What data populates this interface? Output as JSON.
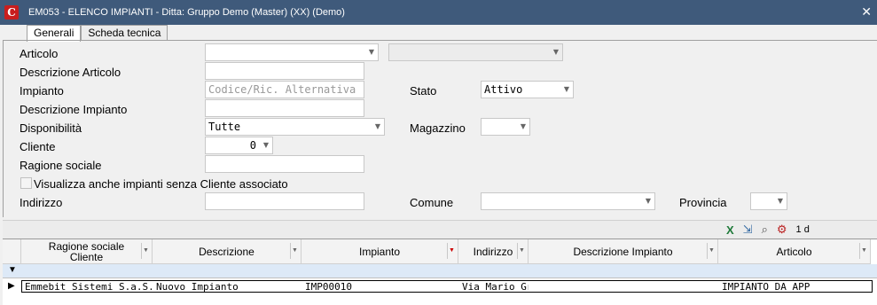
{
  "window": {
    "title": "EM053 - ELENCO IMPIANTI - Ditta: Gruppo Demo (Master) (XX)  (Demo)",
    "app_icon": "C",
    "close": "✕"
  },
  "tabs": [
    {
      "label": "Generali"
    },
    {
      "label": "Scheda tecnica"
    }
  ],
  "form": {
    "articolo": {
      "label": "Articolo",
      "value": ""
    },
    "descrizione_articolo": {
      "label": "Descrizione Articolo",
      "value": ""
    },
    "impianto": {
      "label": "Impianto",
      "placeholder": "Codice/Ric. Alternativa"
    },
    "stato": {
      "label": "Stato",
      "value": "Attivo"
    },
    "descrizione_impianto": {
      "label": "Descrizione Impianto",
      "value": ""
    },
    "disponibilita": {
      "label": "Disponibilità",
      "value": "Tutte"
    },
    "magazzino": {
      "label": "Magazzino",
      "value": ""
    },
    "cliente": {
      "label": "Cliente",
      "value": "0"
    },
    "ragione_sociale": {
      "label": "Ragione sociale",
      "value": ""
    },
    "visualizza": {
      "label": "Visualizza anche impianti senza Cliente associato"
    },
    "indirizzo": {
      "label": "Indirizzo",
      "value": ""
    },
    "comune": {
      "label": "Comune",
      "value": ""
    },
    "provincia": {
      "label": "Provincia",
      "value": ""
    }
  },
  "toolbar": {
    "page_text": "1 d"
  },
  "grid": {
    "columns": [
      {
        "label": "Ragione sociale\nCliente"
      },
      {
        "label": "Descrizione"
      },
      {
        "label": "Impianto"
      },
      {
        "label": "Indirizzo"
      },
      {
        "label": "Descrizione Impianto"
      },
      {
        "label": "Articolo"
      }
    ],
    "rows": [
      {
        "ragione_sociale": "Emmebit Sistemi S.a.S.",
        "descrizione": "Nuovo Impianto",
        "impianto": "IMP00010",
        "indirizzo": "Via Mario Gr",
        "descrizione_impianto": "",
        "articolo": "IMPIANTO DA APP"
      }
    ]
  }
}
